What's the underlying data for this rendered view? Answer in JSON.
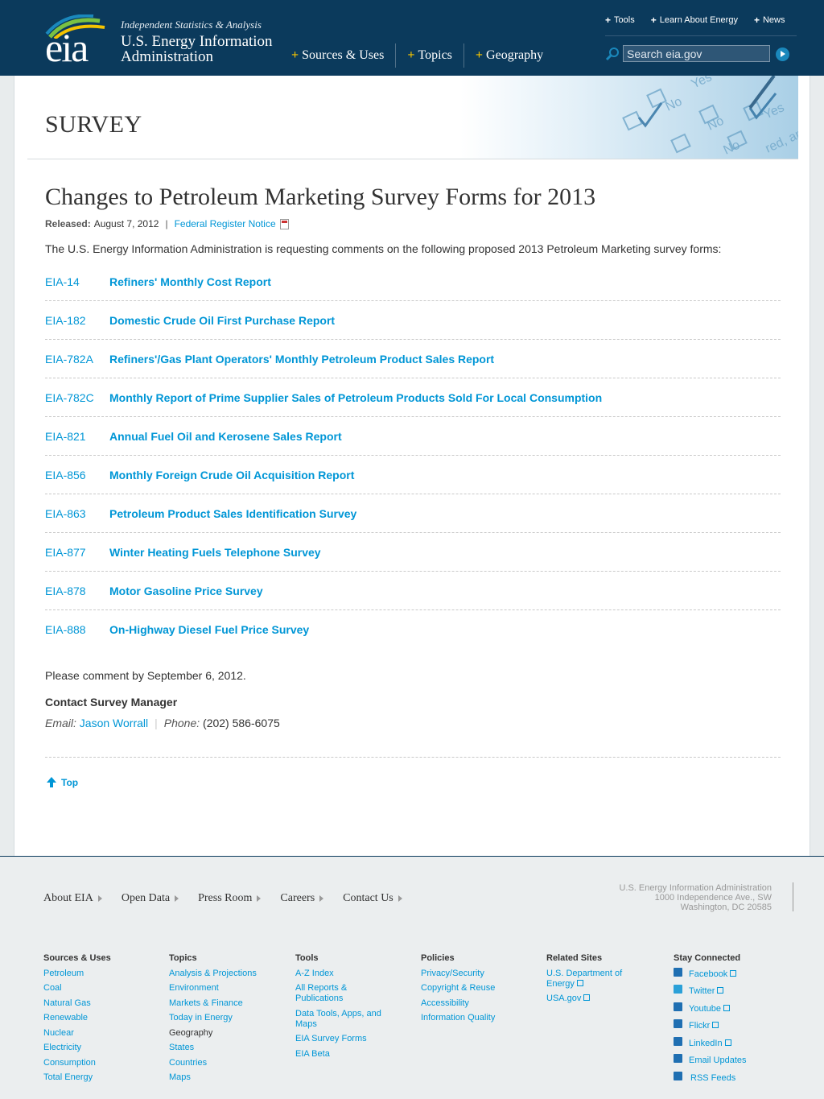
{
  "header": {
    "logo_text": "eia",
    "tagline": "Independent Statistics & Analysis",
    "org_name_line1": "U.S. Energy Information",
    "org_name_line2": "Administration",
    "main_nav": [
      "Sources & Uses",
      "Topics",
      "Geography"
    ],
    "utility_nav": [
      "Tools",
      "Learn About Energy",
      "News"
    ],
    "search_placeholder": "Search eia.gov"
  },
  "banner": {
    "title": "SURVEY"
  },
  "article": {
    "title": "Changes to Petroleum Marketing Survey Forms for 2013",
    "released_label": "Released:",
    "released_date": "August 7, 2012",
    "separator": "|",
    "federal_link": "Federal Register Notice",
    "intro": "The U.S. Energy Information Administration is requesting comments on the following proposed 2013 Petroleum Marketing survey forms:",
    "forms": [
      {
        "code": "EIA-14",
        "name": "Refiners' Monthly Cost Report"
      },
      {
        "code": "EIA-182",
        "name": "Domestic Crude Oil First Purchase Report"
      },
      {
        "code": "EIA-782A",
        "name": "Refiners'/Gas Plant Operators' Monthly Petroleum Product Sales Report"
      },
      {
        "code": "EIA-782C",
        "name": "Monthly Report of Prime Supplier Sales of Petroleum Products Sold For Local Consumption"
      },
      {
        "code": "EIA-821",
        "name": "Annual Fuel Oil and Kerosene Sales Report"
      },
      {
        "code": "EIA-856",
        "name": "Monthly Foreign Crude Oil Acquisition Report"
      },
      {
        "code": "EIA-863",
        "name": "Petroleum Product Sales Identification Survey"
      },
      {
        "code": "EIA-877",
        "name": "Winter Heating Fuels Telephone Survey"
      },
      {
        "code": "EIA-878",
        "name": "Motor Gasoline Price Survey"
      },
      {
        "code": "EIA-888",
        "name": "On-Highway Diesel Fuel Price Survey"
      }
    ],
    "deadline": "Please comment by September 6, 2012.",
    "contact_title": "Contact Survey Manager",
    "email_label": "Email:",
    "email_name": "Jason Worrall",
    "phone_label": "Phone:",
    "phone": "(202) 586-6075",
    "top_link": "Top"
  },
  "footer": {
    "nav": [
      "About EIA",
      "Open Data",
      "Press Room",
      "Careers",
      "Contact Us"
    ],
    "address": [
      "U.S. Energy Information Administration",
      "1000 Independence Ave., SW",
      "Washington, DC 20585"
    ],
    "sources_title": "Sources & Uses",
    "sources": [
      "Petroleum",
      "Coal",
      "Natural Gas",
      "Renewable",
      "Nuclear",
      "Electricity",
      "Consumption",
      "Total Energy"
    ],
    "topics_title": "Topics",
    "topics": [
      "Analysis & Projections",
      "Environment",
      "Markets & Finance",
      "Today in Energy"
    ],
    "geography_title": "Geography",
    "geography": [
      "States",
      "Countries",
      "Maps"
    ],
    "tools_title": "Tools",
    "tools": [
      "A-Z Index",
      "All Reports & Publications",
      "Data Tools, Apps, and Maps",
      "EIA Survey Forms",
      "EIA Beta"
    ],
    "policies_title": "Policies",
    "policies": [
      "Privacy/Security",
      "Copyright & Reuse",
      "Accessibility",
      "Information Quality"
    ],
    "related_title": "Related Sites",
    "related": [
      "U.S. Department of Energy",
      "USA.gov"
    ],
    "connected_title": "Stay Connected",
    "connected": [
      "Facebook",
      "Twitter",
      "Youtube",
      "Flickr",
      "LinkedIn",
      "Email Updates",
      "RSS Feeds"
    ]
  },
  "colors": {
    "header_bg": "#0b3a5c",
    "link": "#0096d6",
    "accent_plus": "#f5c300"
  }
}
